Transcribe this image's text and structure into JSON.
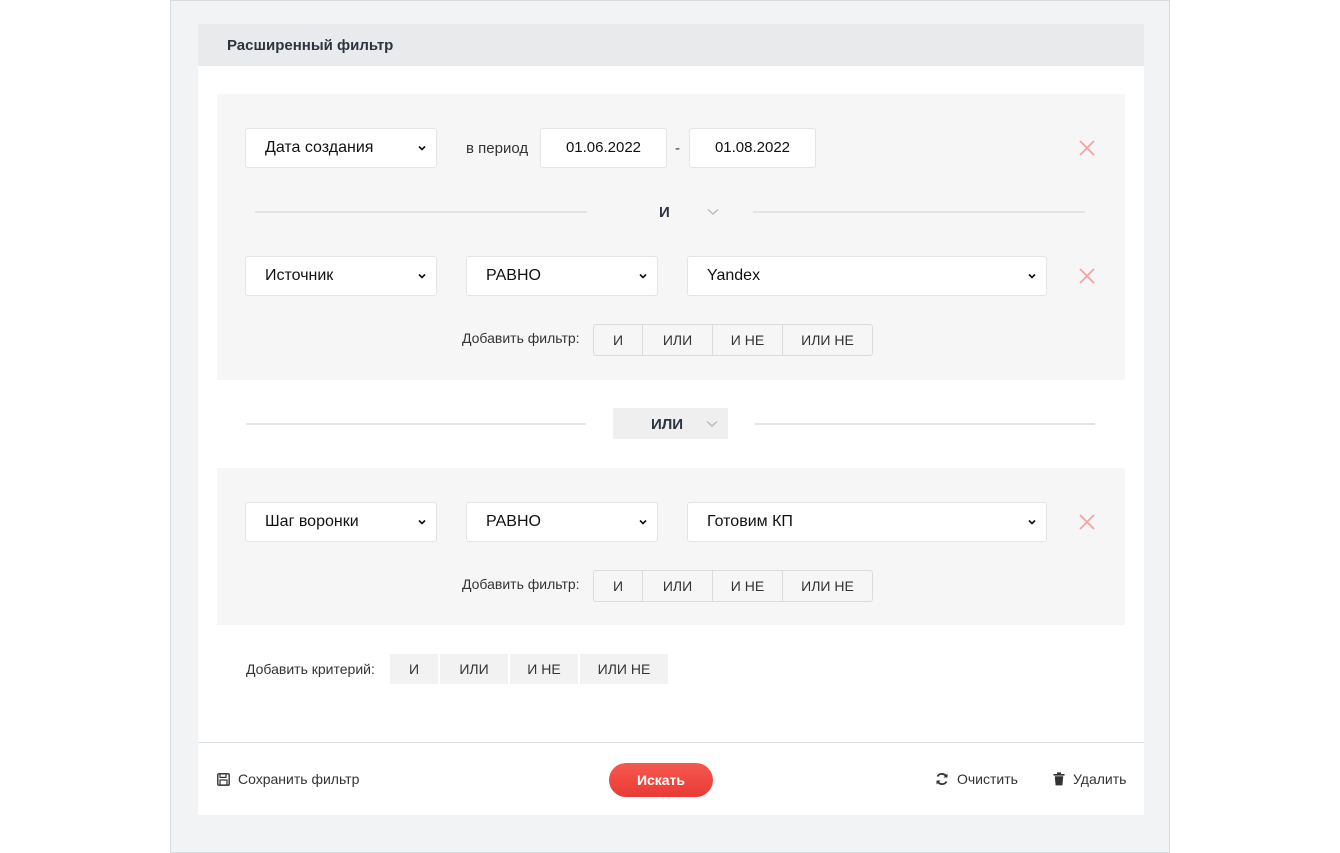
{
  "panel": {
    "title": "Расширенный фильтр"
  },
  "group1": {
    "row1": {
      "field": "Дата создания",
      "period_label": "в период",
      "date_from": "01.06.2022",
      "dash": "-",
      "date_to": "01.08.2022"
    },
    "connector": "И",
    "row2": {
      "field": "Источник",
      "operator": "РАВНО",
      "value": "Yandex"
    },
    "add_filter": {
      "label": "Добавить фильтр:",
      "buttons": [
        "И",
        "ИЛИ",
        "И НЕ",
        "ИЛИ НЕ"
      ]
    }
  },
  "between_groups": {
    "connector": "ИЛИ"
  },
  "group2": {
    "row1": {
      "field": "Шаг воронки",
      "operator": "РАВНО",
      "value": "Готовим КП"
    },
    "add_filter": {
      "label": "Добавить фильтр:",
      "buttons": [
        "И",
        "ИЛИ",
        "И НЕ",
        "ИЛИ НЕ"
      ]
    }
  },
  "add_criterion": {
    "label": "Добавить критерий:",
    "buttons": [
      "И",
      "ИЛИ",
      "И НЕ",
      "ИЛИ НЕ"
    ]
  },
  "footer": {
    "save": "Сохранить фильтр",
    "search": "Искать",
    "clear": "Очистить",
    "delete": "Удалить"
  },
  "colors": {
    "accent": "#ee4540",
    "remove_icon": "#f3a3a3",
    "group_bg": "#f6f6f7",
    "header_bg": "#e9eaec"
  },
  "icons": {
    "remove": "close-icon",
    "save": "floppy-disk-icon",
    "clear": "refresh-icon",
    "delete": "trash-icon",
    "select": "chevron-down-icon"
  }
}
